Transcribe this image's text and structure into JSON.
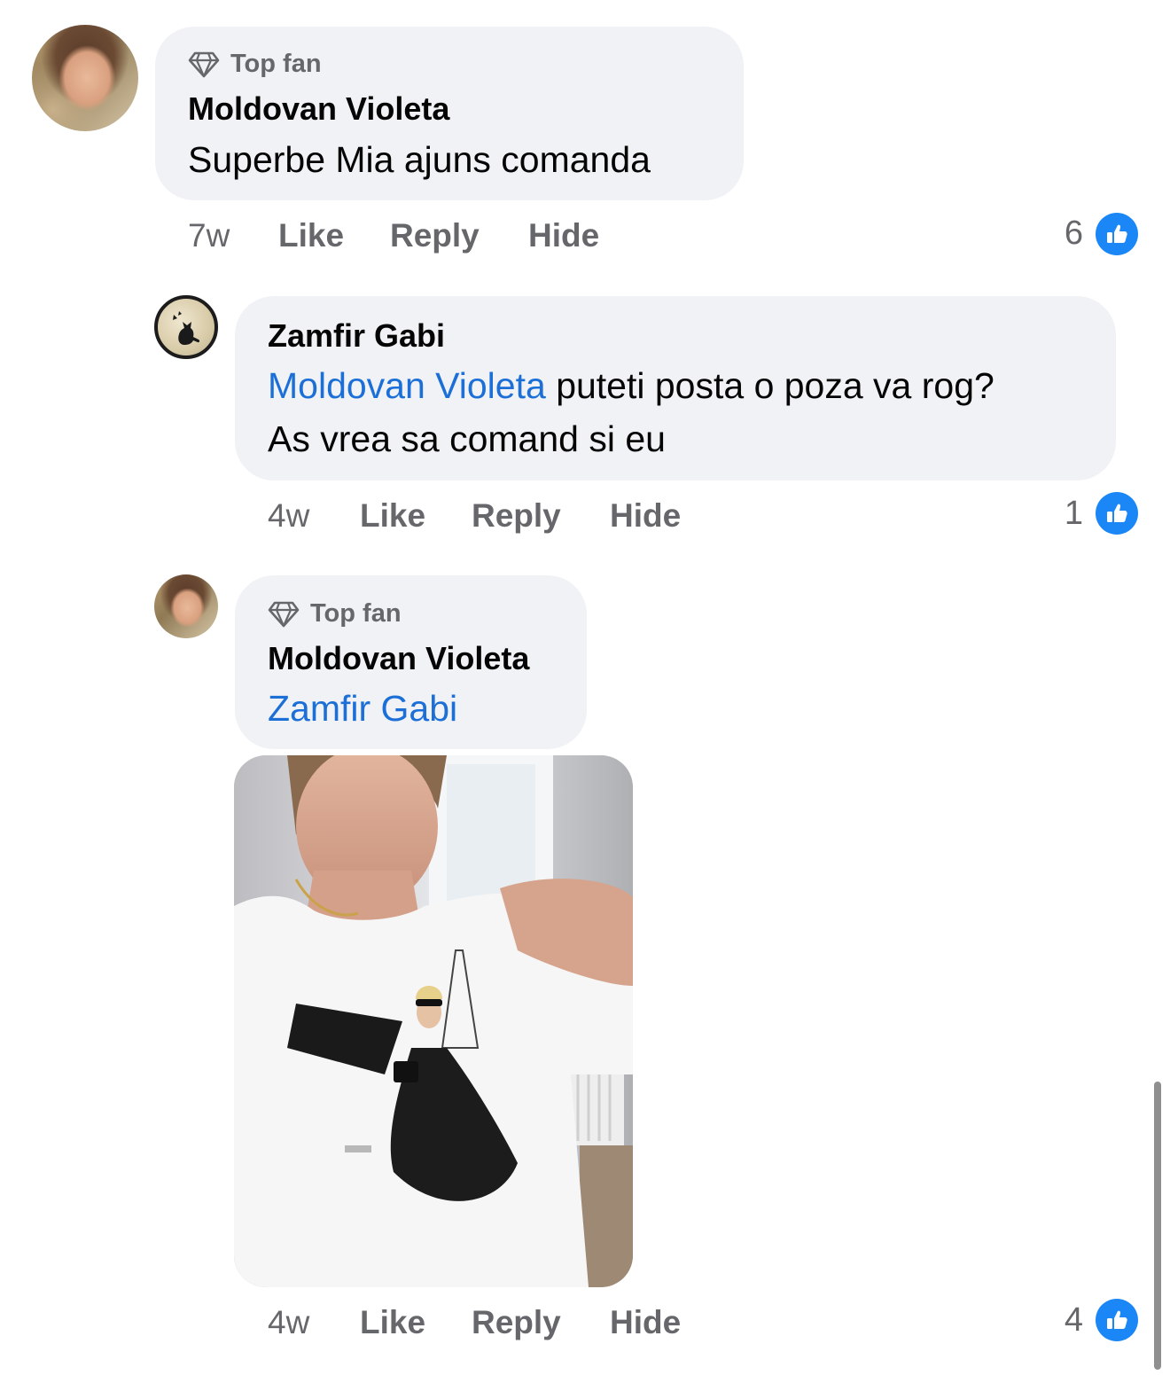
{
  "comments": [
    {
      "badge": "Top fan",
      "author": "Moldovan Violeta",
      "text": "Superbe  Mia ajuns comanda",
      "time": "7w",
      "like_label": "Like",
      "reply_label": "Reply",
      "hide_label": "Hide",
      "reaction_count": "6"
    },
    {
      "author": "Zamfir Gabi",
      "mention": "Moldovan Violeta",
      "text_line1": " puteti posta o poza va rog?",
      "text_line2": "As vrea sa comand si eu",
      "time": "4w",
      "like_label": "Like",
      "reply_label": "Reply",
      "hide_label": "Hide",
      "reaction_count": "1"
    },
    {
      "badge": "Top fan",
      "author": "Moldovan Violeta",
      "mention": "Zamfir Gabi",
      "time": "4w",
      "like_label": "Like",
      "reply_label": "Reply",
      "hide_label": "Hide",
      "reaction_count": "4"
    }
  ],
  "icons": {
    "badge_icon": "diamond-icon",
    "reaction_icon": "thumbs-up-icon"
  },
  "colors": {
    "bubble": "#f0f2f5",
    "mention": "#1b6fd6",
    "meta_text": "#65676b",
    "like_badge": "#1b86f5"
  }
}
